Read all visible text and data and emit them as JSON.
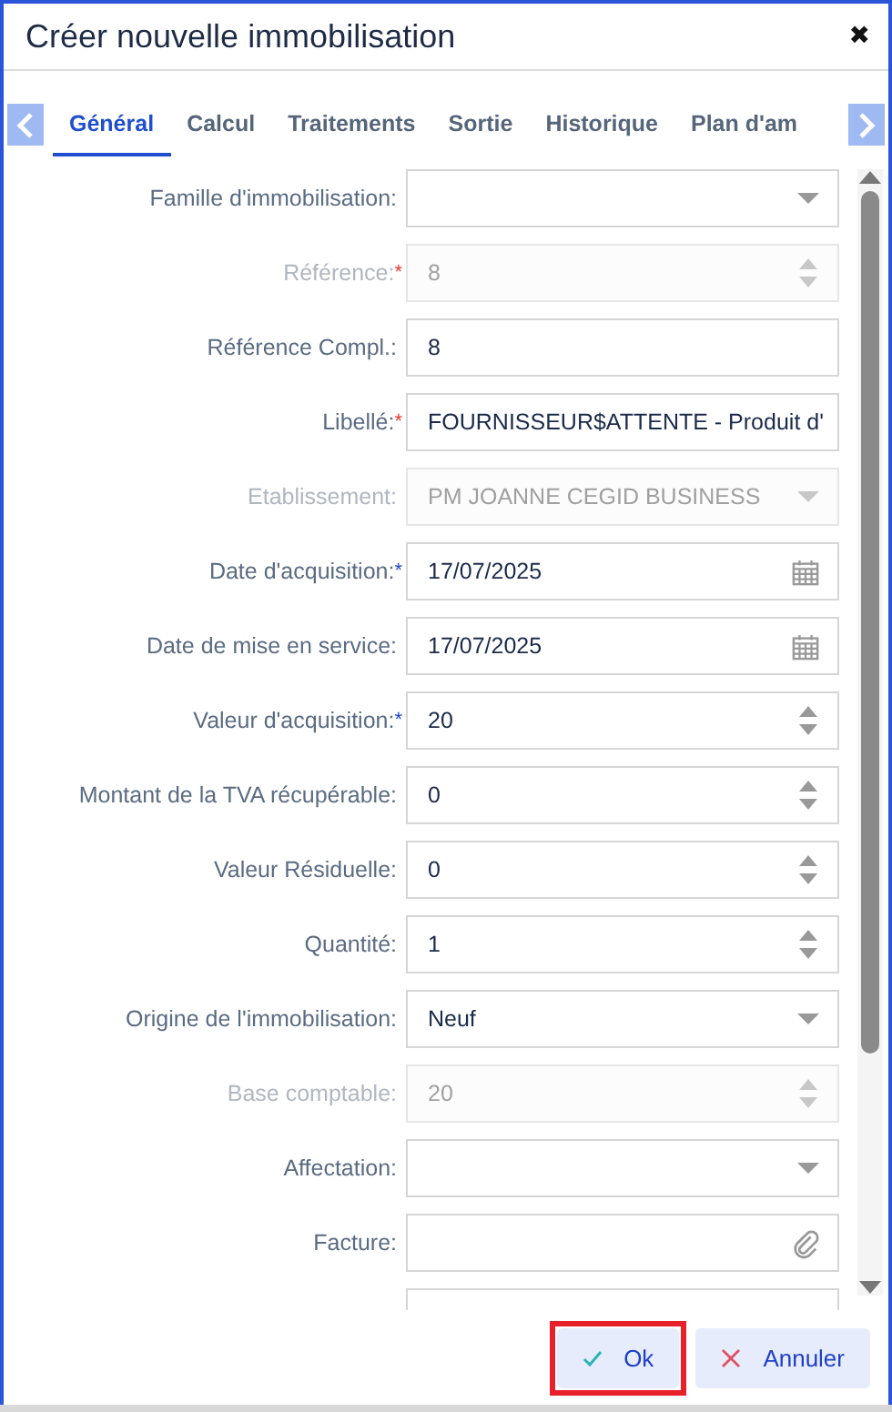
{
  "window": {
    "title": "Créer nouvelle immobilisation",
    "close": "✖"
  },
  "tabs": [
    {
      "label": "Général",
      "selected": true
    },
    {
      "label": "Calcul",
      "selected": false
    },
    {
      "label": "Traitements",
      "selected": false
    },
    {
      "label": "Sortie",
      "selected": false
    },
    {
      "label": "Historique",
      "selected": false
    },
    {
      "label": "Plan d'am",
      "selected": false
    }
  ],
  "fields": [
    {
      "label": "Famille d'immobilisation:",
      "kind": "select",
      "disabled": false
    },
    {
      "label": "Référence:",
      "kind": "spinner",
      "value": "8",
      "disabled": true,
      "marker": "*",
      "color": "#e53935"
    },
    {
      "label": "Référence Compl.:",
      "kind": "text",
      "value": "8",
      "disabled": false
    },
    {
      "label": "Libellé:",
      "kind": "text",
      "value": "FOURNISSEUR$ATTENTE - Produit d'",
      "disabled": false,
      "marker": "*",
      "color": "#e53935"
    },
    {
      "label": "Etablissement:",
      "kind": "select",
      "value": "PM JOANNE CEGID BUSINESS",
      "disabled": true
    },
    {
      "label": "Date d'acquisition:",
      "kind": "date",
      "value": "17/07/2025",
      "disabled": false,
      "marker": "*",
      "color": "#1a3fd0"
    },
    {
      "label": "Date de mise en service:",
      "kind": "date",
      "value": "17/07/2025",
      "disabled": false
    },
    {
      "label": "Valeur d'acquisition:",
      "kind": "spinner",
      "value": "20",
      "disabled": false,
      "marker": "*",
      "color": "#1a3fd0"
    },
    {
      "label": "Montant de la TVA récupérable:",
      "kind": "spinner",
      "value": "0",
      "disabled": false
    },
    {
      "label": "Valeur Résiduelle:",
      "kind": "spinner",
      "value": "0",
      "disabled": false
    },
    {
      "label": "Quantité:",
      "kind": "spinner",
      "value": "1",
      "disabled": false
    },
    {
      "label": "Origine de l'immobilisation:",
      "kind": "select",
      "value": "Neuf",
      "disabled": false
    },
    {
      "label": "Base comptable:",
      "kind": "spinner",
      "value": "20",
      "disabled": true
    },
    {
      "label": "Affectation:",
      "kind": "select",
      "disabled": false
    },
    {
      "label": "Facture:",
      "kind": "file",
      "disabled": false
    },
    {
      "kind": "text",
      "disabled": false
    }
  ],
  "buttons": [
    {
      "label": "Ok",
      "kind": "ok",
      "highlighted": true
    },
    {
      "label": "Annuler",
      "kind": "cancel",
      "highlighted": false
    }
  ]
}
